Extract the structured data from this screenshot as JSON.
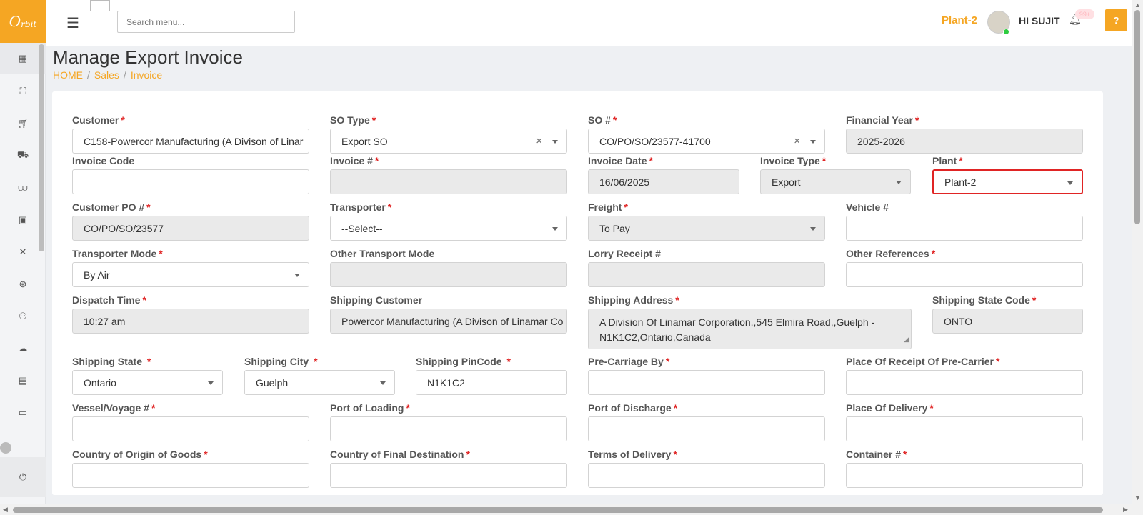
{
  "app": {
    "logo_text": "O",
    "logo_sub": "rbit",
    "broken_image_text": "..."
  },
  "topbar": {
    "search_placeholder": "Search menu...",
    "plant": "Plant-2",
    "greeting": "HI SUJIT",
    "notification_count": "99+",
    "help_symbol": "?"
  },
  "page": {
    "title": "Manage Export Invoice",
    "breadcrumb": [
      "HOME",
      "Sales",
      "Invoice"
    ]
  },
  "sidebar": {
    "icons": [
      "dashboard-icon",
      "expand-icon",
      "cart-icon",
      "truck-icon",
      "paint-icon",
      "boxes-icon",
      "tools-icon",
      "settings-circle-icon",
      "users-icon",
      "cloud-icon",
      "store-icon",
      "monitor-icon"
    ],
    "power_symbol": "⏻"
  },
  "form": {
    "customer": {
      "label": "Customer",
      "value": "C158-Powercor Manufacturing (A Divison of Linar"
    },
    "so_type": {
      "label": "SO Type",
      "value": "Export SO"
    },
    "so_no": {
      "label": "SO #",
      "value": "CO/PO/SO/23577-41700"
    },
    "financial_year": {
      "label": "Financial Year",
      "value": "2025-2026"
    },
    "invoice_code": {
      "label": "Invoice Code",
      "value": ""
    },
    "invoice_no": {
      "label": "Invoice #",
      "value": ""
    },
    "invoice_date": {
      "label": "Invoice Date",
      "value": "16/06/2025"
    },
    "invoice_type": {
      "label": "Invoice Type",
      "value": "Export"
    },
    "plant": {
      "label": "Plant",
      "value": "Plant-2"
    },
    "customer_po": {
      "label": "Customer PO #",
      "value": "CO/PO/SO/23577"
    },
    "transporter": {
      "label": "Transporter",
      "value": "--Select--"
    },
    "freight": {
      "label": "Freight",
      "value": "To Pay"
    },
    "vehicle": {
      "label": "Vehicle #",
      "value": ""
    },
    "transporter_mode": {
      "label": "Transporter Mode",
      "value": "By Air"
    },
    "other_transport_mode": {
      "label": "Other Transport Mode",
      "value": ""
    },
    "lorry_receipt": {
      "label": "Lorry Receipt #",
      "value": ""
    },
    "other_references": {
      "label": "Other References",
      "value": ""
    },
    "dispatch_time": {
      "label": "Dispatch Time",
      "value": "10:27 am"
    },
    "shipping_customer": {
      "label": "Shipping Customer",
      "value": "Powercor Manufacturing (A Divison of Linamar Co"
    },
    "shipping_address": {
      "label": "Shipping Address",
      "value": "A Division Of Linamar Corporation,,545 Elmira Road,,Guelph - N1K1C2,Ontario,Canada"
    },
    "shipping_state_code": {
      "label": "Shipping State Code",
      "value": "ONTO"
    },
    "shipping_state": {
      "label": "Shipping State ",
      "value": "Ontario"
    },
    "shipping_city": {
      "label": "Shipping City ",
      "value": "Guelph"
    },
    "shipping_pincode": {
      "label": "Shipping PinCode ",
      "value": "N1K1C2"
    },
    "pre_carriage_by": {
      "label": "Pre-Carriage By",
      "value": ""
    },
    "place_of_receipt": {
      "label": "Place Of Receipt Of Pre-Carrier",
      "value": ""
    },
    "vessel_voyage": {
      "label": "Vessel/Voyage #",
      "value": ""
    },
    "port_of_loading": {
      "label": "Port of Loading",
      "value": ""
    },
    "port_of_discharge": {
      "label": "Port of Discharge",
      "value": ""
    },
    "place_of_delivery": {
      "label": "Place Of Delivery",
      "value": ""
    },
    "country_of_origin": {
      "label": "Country of Origin of Goods",
      "value": ""
    },
    "country_of_destination": {
      "label": "Country of Final Destination",
      "value": ""
    },
    "terms_of_delivery": {
      "label": "Terms of Delivery",
      "value": ""
    },
    "container_no": {
      "label": "Container #",
      "value": ""
    },
    "required_mark": "*",
    "clear_symbol": "×"
  },
  "colors": {
    "accent": "#f5a623",
    "required": "#e02424",
    "readonly_bg": "#eaeaea"
  }
}
